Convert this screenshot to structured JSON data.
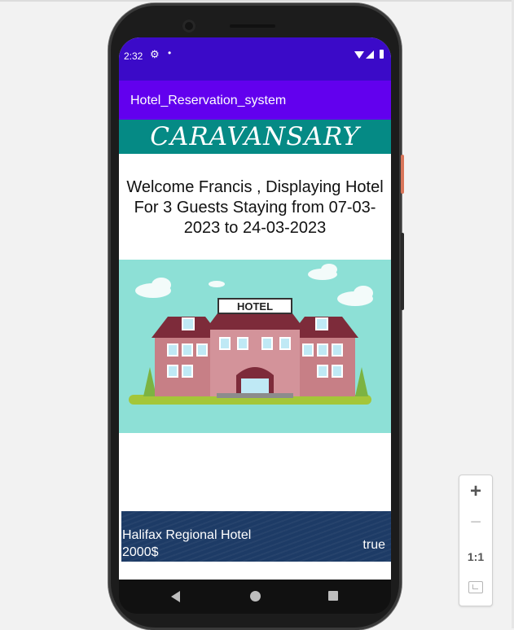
{
  "status_bar": {
    "time": "2:32",
    "icons": [
      "settings-icon",
      "notification-dot-icon",
      "wifi-icon",
      "signal-icon",
      "battery-icon"
    ]
  },
  "app_bar": {
    "title": "Hotel_Reservation_system"
  },
  "banner": {
    "text": "CARAVANSARY"
  },
  "welcome": {
    "text": "Welcome Francis , Displaying Hotel For 3 Guests Staying from 07-03-2023 to 24-03-2023"
  },
  "hotel_image": {
    "sign_text": "HOTEL"
  },
  "hotels": [
    {
      "name": "Halifax Regional Hotel",
      "price": "2000$",
      "availability": "true"
    }
  ],
  "nav_bar": {
    "icons": [
      "back-icon",
      "home-icon",
      "recents-icon"
    ]
  },
  "zoom_controls": {
    "zoom_in": "+",
    "zoom_out": "−",
    "actual_size": "1:1",
    "icons": [
      "fit-screen-icon"
    ]
  },
  "colors": {
    "status_bar": "#3b0ac8",
    "app_bar": "#6200ee",
    "banner": "#058a85",
    "card": "#1d3b66",
    "sky": "#8de0d6"
  }
}
